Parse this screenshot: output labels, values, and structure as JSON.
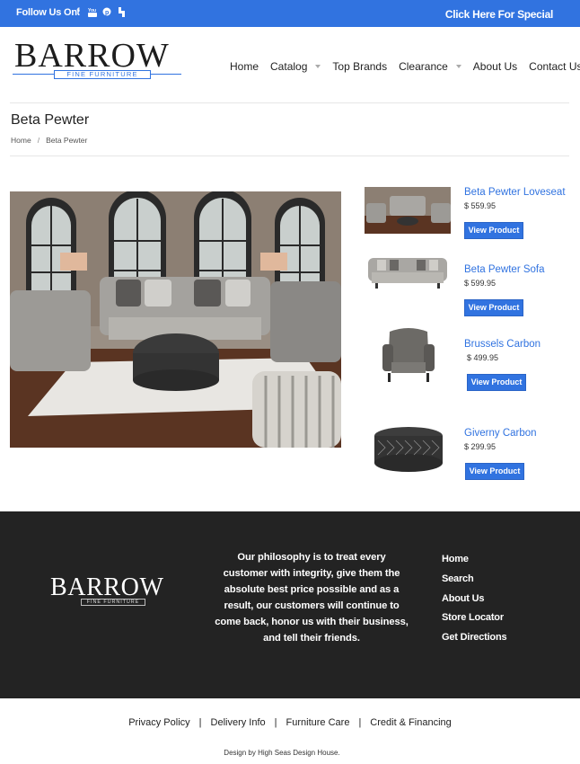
{
  "topbar": {
    "follow_label": "Follow Us On:",
    "social_icons": [
      "facebook-icon",
      "youtube-icon",
      "pinterest-icon",
      "houzz-icon"
    ],
    "special_link": "Click Here For Special"
  },
  "header": {
    "logo_word": "BARROW",
    "logo_sub": "FINE FURNITURE",
    "nav": [
      {
        "label": "Home"
      },
      {
        "label": "Catalog"
      },
      {
        "label": "Top Brands"
      },
      {
        "label": "Clearance"
      },
      {
        "label": "About Us"
      },
      {
        "label": "Contact Us"
      }
    ]
  },
  "page": {
    "title": "Beta Pewter",
    "breadcrumb": {
      "home": "Home",
      "sep": "/",
      "current": "Beta Pewter"
    }
  },
  "products": [
    {
      "name": "Beta Pewter Loveseat",
      "price": "$ 559.95",
      "button": "View Product"
    },
    {
      "name": "Beta Pewter Sofa",
      "price": "$ 599.95",
      "button": "View Product"
    },
    {
      "name": "Brussels Carbon",
      "price": "$ 499.95",
      "button": "View Product"
    },
    {
      "name": "Giverny Carbon",
      "price": "$ 299.95",
      "button": "View Product"
    }
  ],
  "footer": {
    "logo_word": "BARROW",
    "logo_sub": "FINE FURNITURE",
    "philosophy": "Our philosophy is to treat every customer with integrity, give them the absolute best price possible and as a result, our customers will continue to come back, honor us with their business, and tell their friends.",
    "links": [
      "Home",
      "Search",
      "About Us",
      "Store Locator",
      "Get Directions"
    ]
  },
  "bottom": {
    "links": [
      "Privacy Policy",
      "Delivery Info",
      "Furniture Care",
      "Credit & Financing"
    ],
    "separator": "|",
    "credit": "Design by High Seas Design House."
  },
  "colors": {
    "accent": "#3173e0",
    "footer_bg": "#232323"
  }
}
